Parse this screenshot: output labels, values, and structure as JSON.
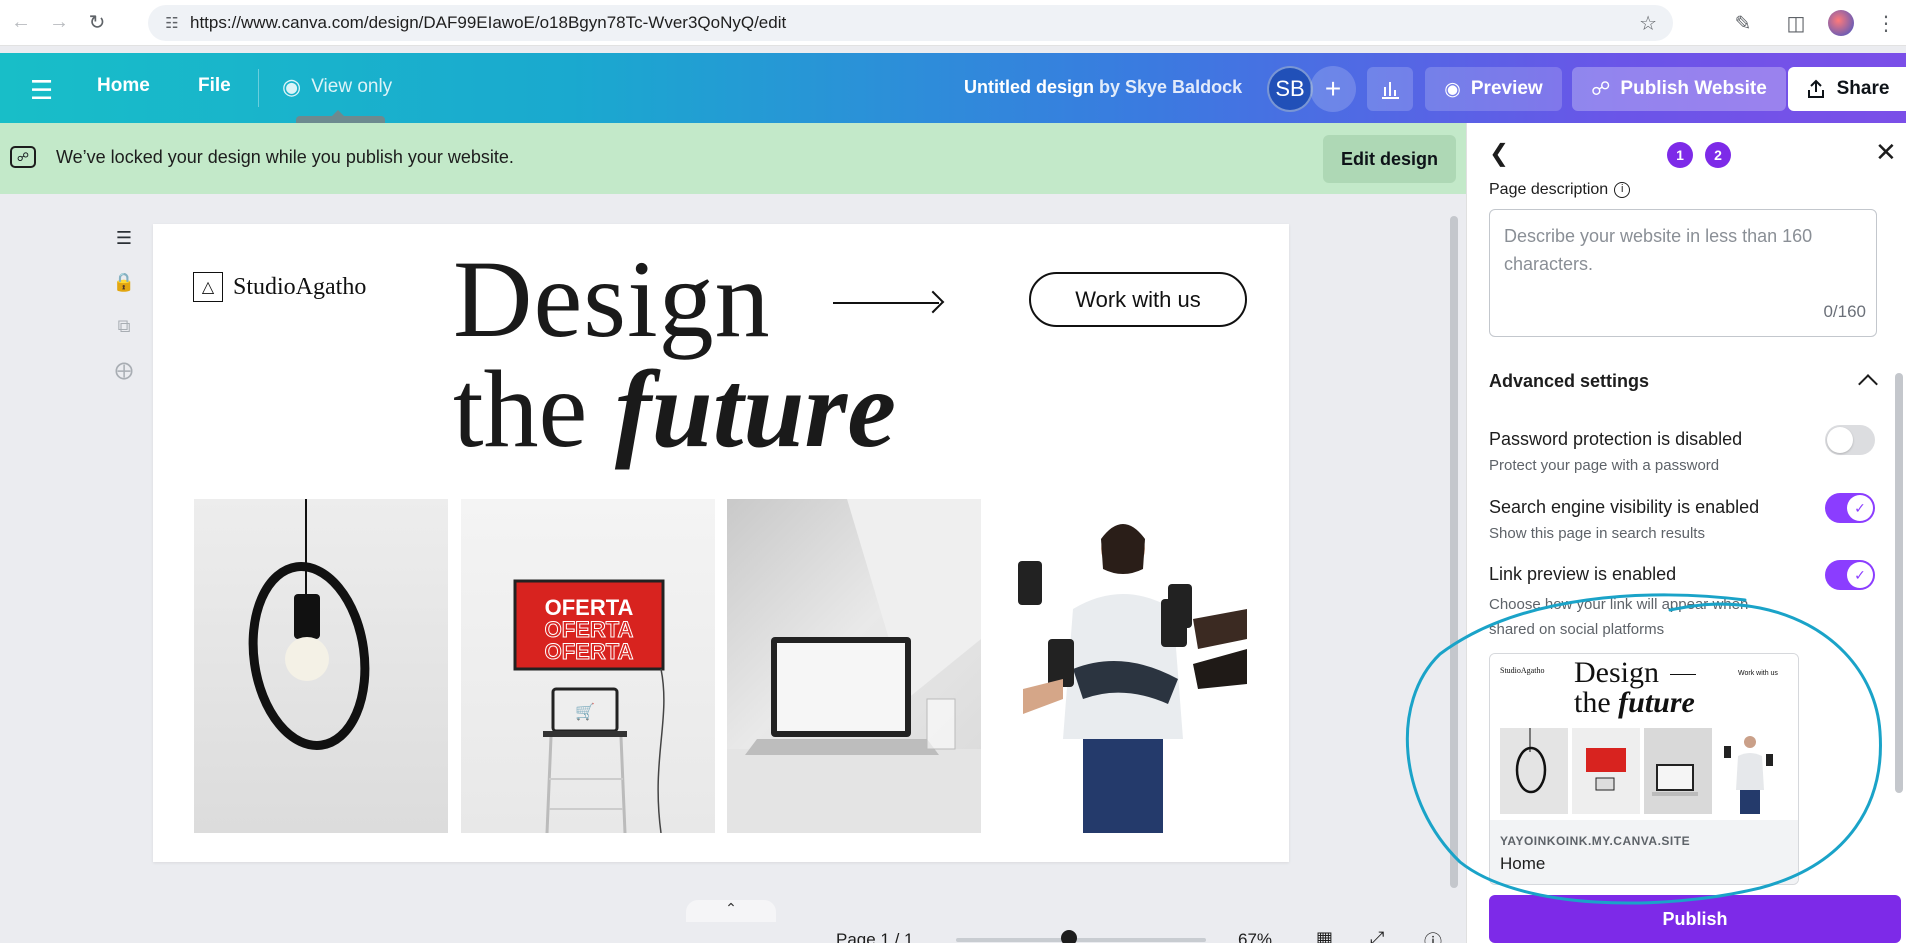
{
  "browser": {
    "url": "https://www.canva.com/design/DAF99EIawoE/o18Bgyn78Tc-Wver3QoNyQ/edit"
  },
  "toolbar": {
    "home_label": "Home",
    "file_label": "File",
    "view_only_label": "View only",
    "tooltip": "View only",
    "design_title": "Untitled design",
    "by_label": "by Skye Baldock",
    "avatar_initials": "SB",
    "preview_label": "Preview",
    "publish_website_label": "Publish Website",
    "share_label": "Share"
  },
  "notice": {
    "message": "We’ve locked your design while you publish your website.",
    "edit_button": "Edit design"
  },
  "design": {
    "logo_text": "StudioAgatho",
    "headline_line1": "Design",
    "headline_the": "the",
    "headline_future": "future",
    "cta": "Work with us",
    "sign_text": "OFERTA"
  },
  "bottom": {
    "page_label": "Page 1 / 1",
    "zoom": "67%",
    "zoom_fraction": 0.45
  },
  "panel": {
    "steps": [
      "1",
      "2"
    ],
    "page_description_label": "Page description",
    "page_description_placeholder": "Describe your website in less than 160 characters.",
    "char_count": "0/160",
    "advanced_title": "Advanced settings",
    "settings": [
      {
        "title": "Password protection is disabled",
        "subtitle": "Protect your page with a password",
        "enabled": false
      },
      {
        "title": "Search engine visibility is enabled",
        "subtitle": "Show this page in search results",
        "enabled": true
      },
      {
        "title": "Link preview is enabled",
        "subtitle": "Choose how your link will appear when shared on social platforms",
        "enabled": true
      }
    ],
    "preview_domain": "YAYOINKOINK.MY.CANVA.SITE",
    "preview_title": "Home",
    "publish_label": "Publish"
  },
  "colors": {
    "accent": "#7d2ae8",
    "notice_bg": "#c3e9c9",
    "annotation": "#1aa3c8"
  }
}
